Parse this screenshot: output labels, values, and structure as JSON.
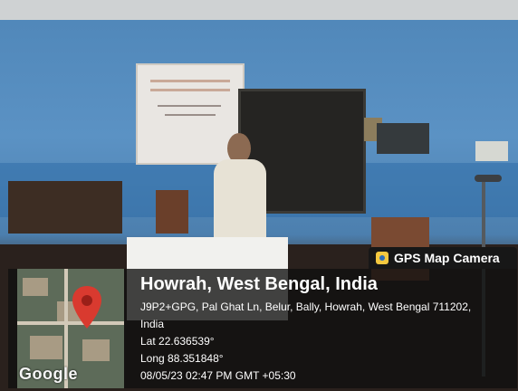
{
  "gps_overlay": {
    "badge_label": "GPS Map Camera",
    "location_title": "Howrah, West Bengal, India",
    "address_line_1": "J9P2+GPG, Pal Ghat Ln, Belur, Bally, Howrah, West Bengal 711202,",
    "address_line_2": "India",
    "latitude": "Lat 22.636539°",
    "longitude": "Long 88.351848°",
    "timestamp": "08/05/23 02:47 PM GMT +05:30",
    "map_brand": "Google"
  },
  "colors": {
    "pin": "#d93a2f",
    "badge_icon": "#f4c83f",
    "overlay_bg": "#151515",
    "wall": "#5b92c4"
  }
}
